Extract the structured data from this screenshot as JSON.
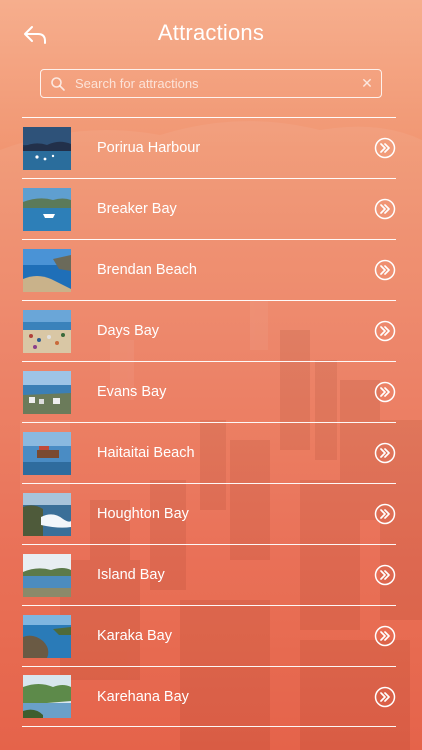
{
  "header": {
    "title": "Attractions",
    "back_icon": "back-arrow-icon"
  },
  "search": {
    "placeholder": "Search for attractions",
    "value": "",
    "icon": "search-icon",
    "clear_icon": "clear-icon"
  },
  "attractions": [
    {
      "name": "Porirua Harbour",
      "thumb": "harbour-night"
    },
    {
      "name": "Breaker Bay",
      "thumb": "bay-boat"
    },
    {
      "name": "Brendan Beach",
      "thumb": "beach-rocks"
    },
    {
      "name": "Days Bay",
      "thumb": "crowded-beach"
    },
    {
      "name": "Evans Bay",
      "thumb": "bay-town"
    },
    {
      "name": "Haitaitai Beach",
      "thumb": "pier-sea"
    },
    {
      "name": "Houghton Bay",
      "thumb": "waves-rocks"
    },
    {
      "name": "Island Bay",
      "thumb": "island-sea"
    },
    {
      "name": "Karaka Bay",
      "thumb": "rocky-shore"
    },
    {
      "name": "Karehana Bay",
      "thumb": "green-hills"
    }
  ],
  "colors": {
    "bg_top": "#f6ae8d",
    "bg_bottom": "#e45a3f",
    "text": "#ffffff"
  }
}
